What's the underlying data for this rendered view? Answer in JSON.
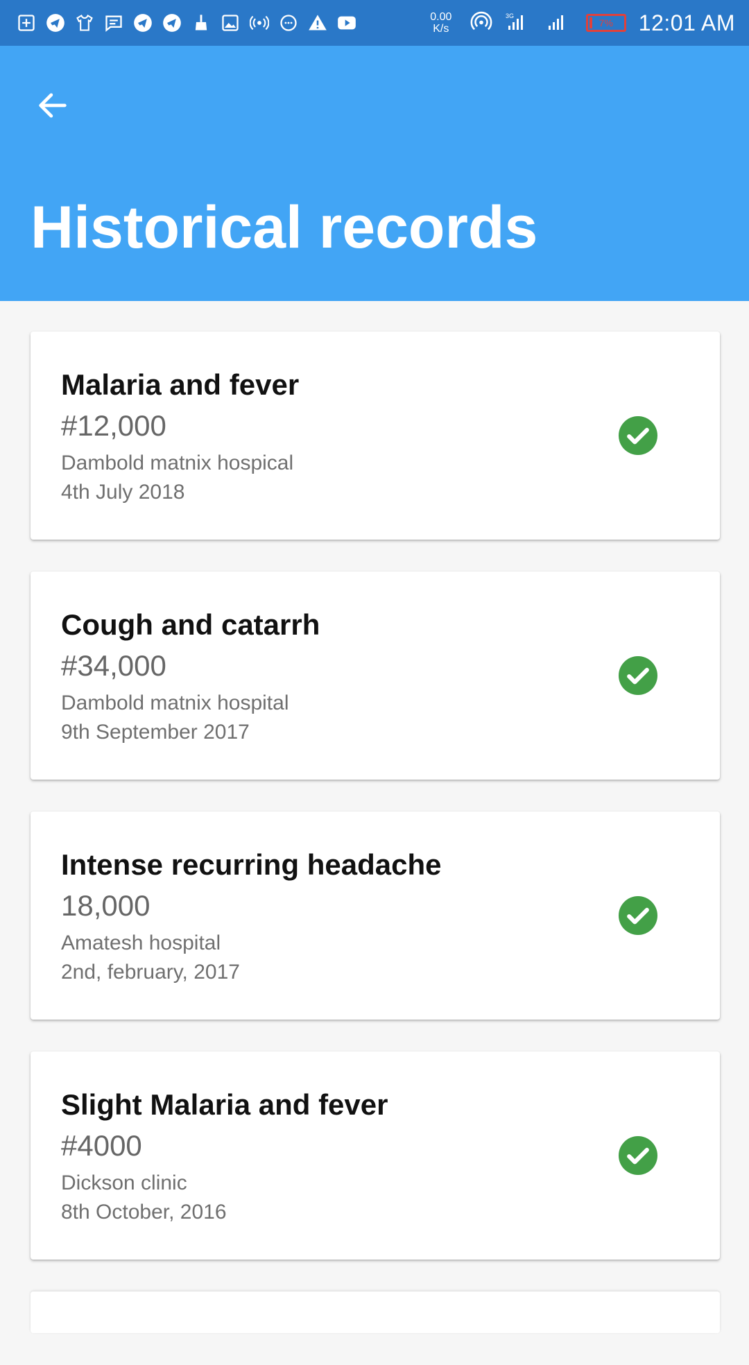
{
  "status_bar": {
    "net_speed_value": "0.00",
    "net_speed_unit": "K/s",
    "network_type": "3G",
    "battery_percent": "7%",
    "battery_level": 0.07,
    "time": "12:01 AM",
    "icons": [
      "plus-box-icon",
      "telegram-icon",
      "tshirt-icon",
      "message-icon",
      "telegram-icon",
      "telegram-icon",
      "broom-icon",
      "image-icon",
      "broadcast-icon",
      "chat-bubble-icon",
      "warning-icon",
      "youtube-icon",
      "hotspot-icon",
      "signal-icon",
      "signal-icon",
      "battery-icon"
    ]
  },
  "app_bar": {
    "back_icon": "arrow-back-icon",
    "title": "Historical records",
    "color": "#42a5f5"
  },
  "records": [
    {
      "title": "Malaria and fever",
      "amount": "#12,000",
      "hospital": "Dambold matnix hospical",
      "date": "4th July 2018",
      "status_icon": "check-circle-icon"
    },
    {
      "title": "Cough and catarrh",
      "amount": "#34,000",
      "hospital": "Dambold matnix hospital",
      "date": "9th September 2017",
      "status_icon": "check-circle-icon"
    },
    {
      "title": "Intense recurring headache",
      "amount": "18,000",
      "hospital": "Amatesh hospital",
      "date": "2nd, february, 2017",
      "status_icon": "check-circle-icon"
    },
    {
      "title": "Slight Malaria and fever",
      "amount": "#4000",
      "hospital": "Dickson clinic",
      "date": "8th October, 2016",
      "status_icon": "check-circle-icon"
    }
  ],
  "colors": {
    "status_bar": "#2a78c8",
    "app_bar": "#42a5f5",
    "check_green": "#43a047",
    "background": "#f6f6f6"
  }
}
